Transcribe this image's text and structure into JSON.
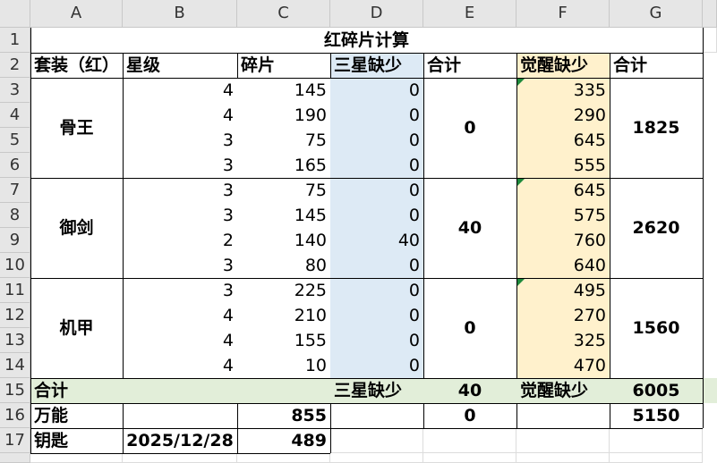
{
  "columns": [
    "A",
    "B",
    "C",
    "D",
    "E",
    "F",
    "G"
  ],
  "rows": [
    "1",
    "2",
    "3",
    "4",
    "5",
    "6",
    "7",
    "8",
    "9",
    "10",
    "11",
    "12",
    "13",
    "14",
    "15",
    "16",
    "17"
  ],
  "title": "红碎片计算",
  "header": {
    "set": "套装（红）",
    "star": "星级",
    "shards": "碎片",
    "three_star_short": "三星缺少",
    "total1": "合计",
    "awaken_short": "觉醒缺少",
    "total2": "合计"
  },
  "groups": [
    {
      "name": "骨王",
      "total_three_star": "0",
      "total_awaken": "1825",
      "rows": [
        {
          "star": "4",
          "shards": "145",
          "three_star": "0",
          "awaken": "335"
        },
        {
          "star": "4",
          "shards": "190",
          "three_star": "0",
          "awaken": "290"
        },
        {
          "star": "3",
          "shards": "75",
          "three_star": "0",
          "awaken": "645"
        },
        {
          "star": "3",
          "shards": "165",
          "three_star": "0",
          "awaken": "555"
        }
      ]
    },
    {
      "name": "御剑",
      "total_three_star": "40",
      "total_awaken": "2620",
      "rows": [
        {
          "star": "3",
          "shards": "75",
          "three_star": "0",
          "awaken": "645"
        },
        {
          "star": "3",
          "shards": "145",
          "three_star": "0",
          "awaken": "575"
        },
        {
          "star": "2",
          "shards": "140",
          "three_star": "40",
          "awaken": "760"
        },
        {
          "star": "3",
          "shards": "80",
          "three_star": "0",
          "awaken": "640"
        }
      ]
    },
    {
      "name": "机甲",
      "total_three_star": "0",
      "total_awaken": "1560",
      "rows": [
        {
          "star": "3",
          "shards": "225",
          "three_star": "0",
          "awaken": "495"
        },
        {
          "star": "4",
          "shards": "210",
          "three_star": "0",
          "awaken": "270"
        },
        {
          "star": "4",
          "shards": "155",
          "three_star": "0",
          "awaken": "325"
        },
        {
          "star": "4",
          "shards": "10",
          "three_star": "0",
          "awaken": "470"
        }
      ]
    }
  ],
  "summary": {
    "label": "合计",
    "three_star_label": "三星缺少",
    "three_star_total": "40",
    "awaken_label": "觉醒缺少",
    "awaken_total": "6005"
  },
  "universal": {
    "label": "万能",
    "shards": "855",
    "three_star": "0",
    "awaken": "5150"
  },
  "key": {
    "label": "钥匙",
    "date": "2025/12/28",
    "value": "489"
  },
  "colors": {
    "blue_fill": "#ddeaf5",
    "yellow_fill": "#fff1cc",
    "green_fill": "#e2eed9",
    "comment_marker": "#1e8a3c"
  }
}
